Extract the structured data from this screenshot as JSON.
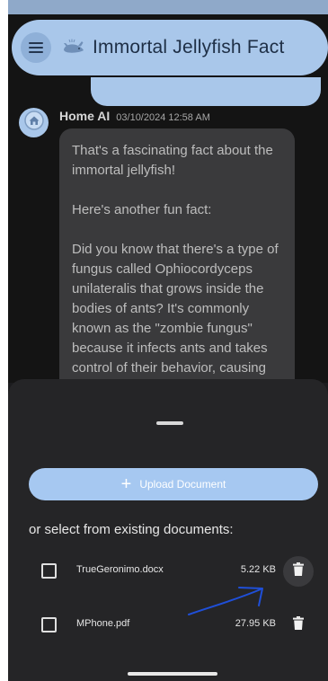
{
  "header": {
    "title": "Immortal Jellyfish Fact",
    "menu_icon": "hamburger-menu-icon",
    "title_icon": "whale-icon"
  },
  "message": {
    "sender": "Home AI",
    "timestamp": "03/10/2024 12:58 AM",
    "avatar_icon": "home-icon",
    "paragraphs": [
      "That's a fascinating fact about the immortal jellyfish!",
      "Here's another fun fact:",
      "Did you know that there's a type of fungus called Ophiocordyceps unilateralis that grows inside the bodies of ants? It's commonly known as the \"zombie fungus\" because it infects ants and takes control of their behavior, causing them to climb to high"
    ]
  },
  "sheet": {
    "upload_label": "Upload Document",
    "select_label": "or select from existing documents:",
    "documents": [
      {
        "name": "TrueGeronimo.docx",
        "size": "5.22 KB",
        "checked": false
      },
      {
        "name": "MPhone.pdf",
        "size": "27.95 KB",
        "checked": false
      }
    ]
  },
  "colors": {
    "accent": "#a9c7ea",
    "upload_button": "#a6c8f1",
    "annotation": "#1f4fd8"
  }
}
